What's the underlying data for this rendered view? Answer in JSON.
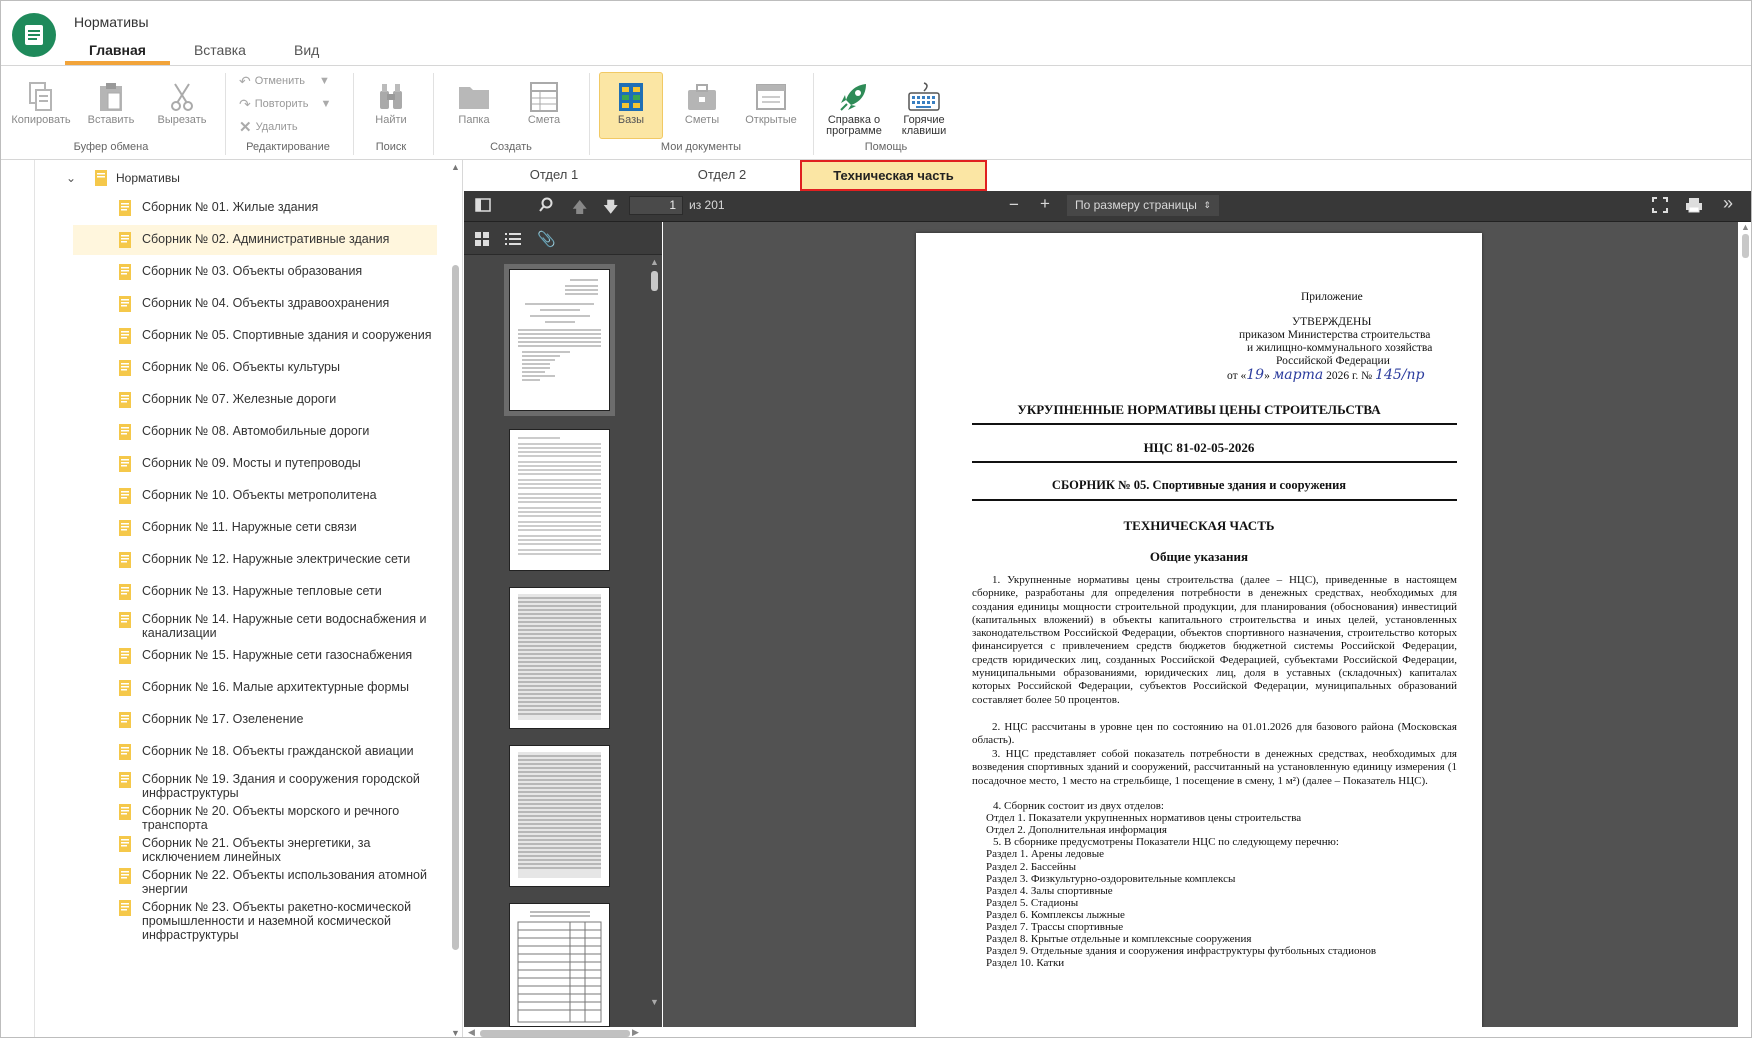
{
  "app": {
    "title": "Нормативы"
  },
  "tabs": [
    "Главная",
    "Вставка",
    "Вид"
  ],
  "ribbon": {
    "clipboard": {
      "copy": "Копировать",
      "paste": "Вставить",
      "cut": "Вырезать",
      "group": "Буфер обмена"
    },
    "edit": {
      "undo": "Отменить",
      "redo": "Повторить",
      "delete": "Удалить",
      "group": "Редактирование"
    },
    "search": {
      "find": "Найти",
      "group": "Поиск"
    },
    "create": {
      "folder": "Папка",
      "estimate": "Смета",
      "group": "Создать"
    },
    "mydocs": {
      "bases": "Базы",
      "estimates": "Сметы",
      "opened": "Открытые",
      "group": "Мои документы"
    },
    "help": {
      "about_1": "Справка о",
      "about_2": "программе",
      "hotkeys_1": "Горячие",
      "hotkeys_2": "клавиши",
      "group": "Помощь"
    }
  },
  "tree": {
    "root": "Нормативы",
    "items": [
      "Сборник № 01. Жилые здания",
      "Сборник № 02. Административные здания",
      "Сборник № 03. Объекты образования",
      "Сборник № 04. Объекты здравоохранения",
      "Сборник № 05. Спортивные здания и сооружения",
      "Сборник № 06. Объекты культуры",
      "Сборник № 07. Железные дороги",
      "Сборник № 08. Автомобильные дороги",
      "Сборник № 09. Мосты и путепроводы",
      "Сборник № 10. Объекты метрополитена",
      "Сборник № 11. Наружные сети связи",
      "Сборник № 12. Наружные электрические сети",
      "Сборник № 13. Наружные тепловые сети",
      "Сборник № 14. Наружные сети водоснабжения и канализации",
      "Сборник № 15. Наружные сети газоснабжения",
      "Сборник № 16. Малые архитектурные формы",
      "Сборник № 17. Озеленение",
      "Сборник № 18. Объекты гражданской авиации",
      "Сборник № 19. Здания и сооружения городской инфраструктуры",
      "Сборник № 20. Объекты морского и речного транспорта",
      "Сборник № 21. Объекты энергетики, за исключением линейных",
      "Сборник № 22. Объекты использования атомной энергии",
      "Сборник № 23. Объекты ракетно-космической промышленности и наземной космической инфраструктуры"
    ],
    "selected_index": 1
  },
  "doc_tabs": [
    "Отдел 1",
    "Отдел 2",
    "Техническая часть"
  ],
  "viewer": {
    "page": "1",
    "of_pages": "из 201",
    "zoom": "По размеру страницы"
  },
  "document": {
    "appendix": "Приложение",
    "approved": "УТВЕРЖДЕНЫ",
    "by_order": "приказом Министерства строительства",
    "ministry": "и жилищно-коммунального хозяйства",
    "country": "Российской Федерации",
    "date_prefix": "от «",
    "date_day": "19",
    "date_mid": "»",
    "date_month": "марта",
    "date_year": "2026 г. №",
    "order_no": "145/пр",
    "title": "УКРУПНЕННЫЕ НОРМАТИВЫ ЦЕНЫ СТРОИТЕЛЬСТВА",
    "code": "НЦС 81-02-05-2026",
    "collection": "СБОРНИК № 05. Спортивные здания и сооружения",
    "section": "ТЕХНИЧЕСКАЯ ЧАСТЬ",
    "general": "Общие указания",
    "para1": "1.   Укрупненные нормативы цены строительства (далее – НЦС), приведенные в настоящем сборнике, разработаны для определения потребности в денежных средствах, необходимых для создания единицы мощности строительной продукции, для планирования (обоснования) инвестиций (капитальных вложений) в объекты капитального строительства и иных целей, установленных законодательством Российской Федерации, объектов спортивного назначения, строительство которых финансируется с привлечением средств бюджетов бюджетной системы Российской Федерации, средств юридических лиц, созданных Российской Федерацией, субъектами Российской Федерации, муниципальными образованиями, юридических лиц, доля в уставных (складочных) капиталах которых Российской Федерации, субъектов Российской Федерации, муниципальных образований составляет более 50 процентов.",
    "para2": "2.   НЦС рассчитаны в уровне цен по состоянию на 01.01.2026 для базового района (Московская область).",
    "para3": "3.   НЦС представляет собой показатель потребности в денежных средствах, необходимых для возведения спортивных зданий и сооружений, рассчитанный на установленную единицу измерения (1 посадочное место, 1 место на стрельбище, 1 посещение в смену, 1 м²) (далее – Показатель НЦС).",
    "lines": [
      "4.   Сборник состоит из двух отделов:",
      "Отдел 1. Показатели укрупненных нормативов цены строительства",
      "Отдел 2. Дополнительная информация",
      "5.   В сборнике предусмотрены Показатели НЦС по следующему перечню:",
      "Раздел 1. Арены ледовые",
      "Раздел 2. Бассейны",
      "Раздел 3. Физкультурно-оздоровительные комплексы",
      "Раздел 4. Залы спортивные",
      "Раздел 5. Стадионы",
      "Раздел 6. Комплексы лыжные",
      "Раздел 7. Трассы спортивные",
      "Раздел 8. Крытые отдельные и комплексные сооружения",
      "Раздел 9. Отдельные здания и сооружения инфраструктуры футбольных стадионов",
      "Раздел 10. Катки"
    ]
  },
  "colors": {
    "accent": "#f2a43a",
    "logo": "#1f8a5b",
    "selected_tab": "#fbe6a4",
    "highlight_border": "#e02020"
  }
}
